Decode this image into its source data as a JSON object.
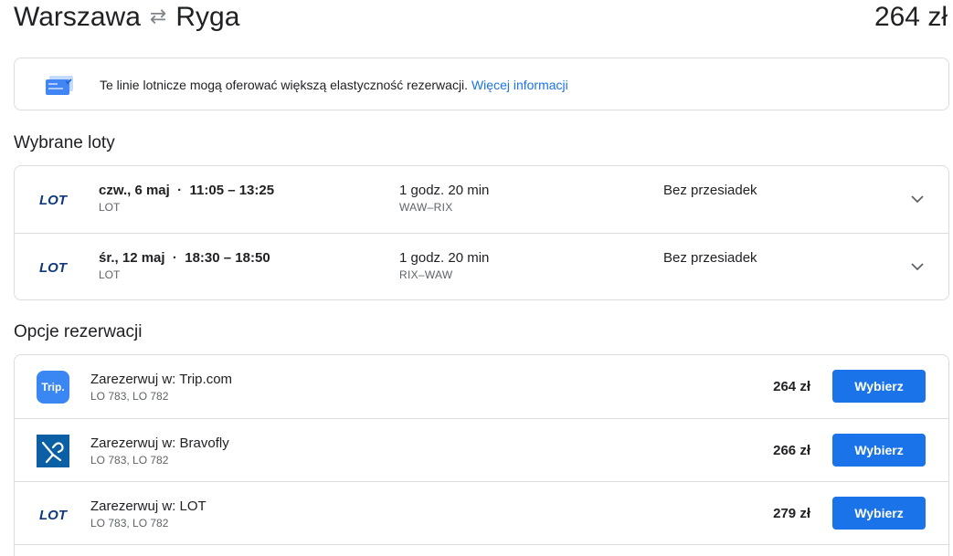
{
  "header": {
    "origin": "Warszawa",
    "swap_icon": "⇄",
    "destination": "Ryga",
    "price": "264 zł"
  },
  "info": {
    "text": "Te linie lotnicze mogą oferować większą elastyczność rezerwacji.",
    "link": "Więcej informacji",
    "icon": "ticket-flex-icon"
  },
  "selected_flights": {
    "title": "Wybrane loty",
    "flights": [
      {
        "date": "czw., 6 maj",
        "times": "11:05 – 13:25",
        "airline": "LOT",
        "duration": "1 godz. 20 min",
        "route": "WAW–RIX",
        "stops": "Bez przesiadek"
      },
      {
        "date": "śr., 12 maj",
        "times": "18:30 – 18:50",
        "airline": "LOT",
        "duration": "1 godz. 20 min",
        "route": "RIX–WAW",
        "stops": "Bez przesiadek"
      }
    ]
  },
  "booking": {
    "title": "Opcje rezerwacji",
    "options": [
      {
        "provider": "Zarezerwuj w: Trip.com",
        "logo_text": "Trip.",
        "flights": "LO 783, LO 782",
        "price": "264 zł",
        "button": "Wybierz"
      },
      {
        "provider": "Zarezerwuj w: Bravofly",
        "flights": "LO 783, LO 782",
        "price": "266 zł",
        "button": "Wybierz"
      },
      {
        "provider": "Zarezerwuj w: LOT",
        "flights": "LO 783, LO 782",
        "price": "279 zł",
        "button": "Wybierz"
      }
    ]
  },
  "colors": {
    "accent": "#1a73e8",
    "border": "#dadce0",
    "lot_navy": "#11397e",
    "trip_blue": "#3a86f3",
    "bravofly_blue": "#0b5fa5"
  }
}
